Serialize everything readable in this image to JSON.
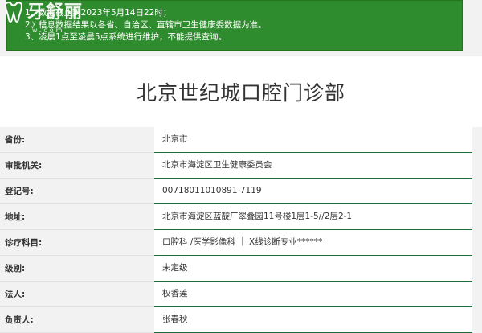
{
  "brand": {
    "logo_text": "牙舒丽",
    "logo_sub": "ysl w.com"
  },
  "notice": {
    "lines": [
      "1、数据截止到2023年5月14日22时；",
      "2、信息数据结果以各省、自治区、直辖市卫生健康委数据为准。",
      "3、凌晨1点至凌晨5点系统进行维护，不能提供查询。"
    ]
  },
  "page": {
    "title": "北京世纪城口腔门诊部"
  },
  "table": {
    "rows": [
      {
        "label": "省份:",
        "value": "北京市"
      },
      {
        "label": "审批机关:",
        "value": "北京市海淀区卫生健康委员会"
      },
      {
        "label": "登记号:",
        "value": "00718011010891 7119"
      },
      {
        "label": "地址:",
        "value": "北京市海淀区蓝靛厂翠叠园11号楼1层1-5//2层2-1"
      },
      {
        "label": "诊疗科目:",
        "value": "口腔科 /医学影像科 ｜ X线诊断专业******"
      },
      {
        "label": "级别:",
        "value": "未定级"
      },
      {
        "label": "法人:",
        "value": "权香莲"
      },
      {
        "label": "负责人:",
        "value": "张春秋"
      }
    ]
  },
  "colors": {
    "notice_bg": "#2e8b2e",
    "row_border": "#1e6e3a"
  }
}
